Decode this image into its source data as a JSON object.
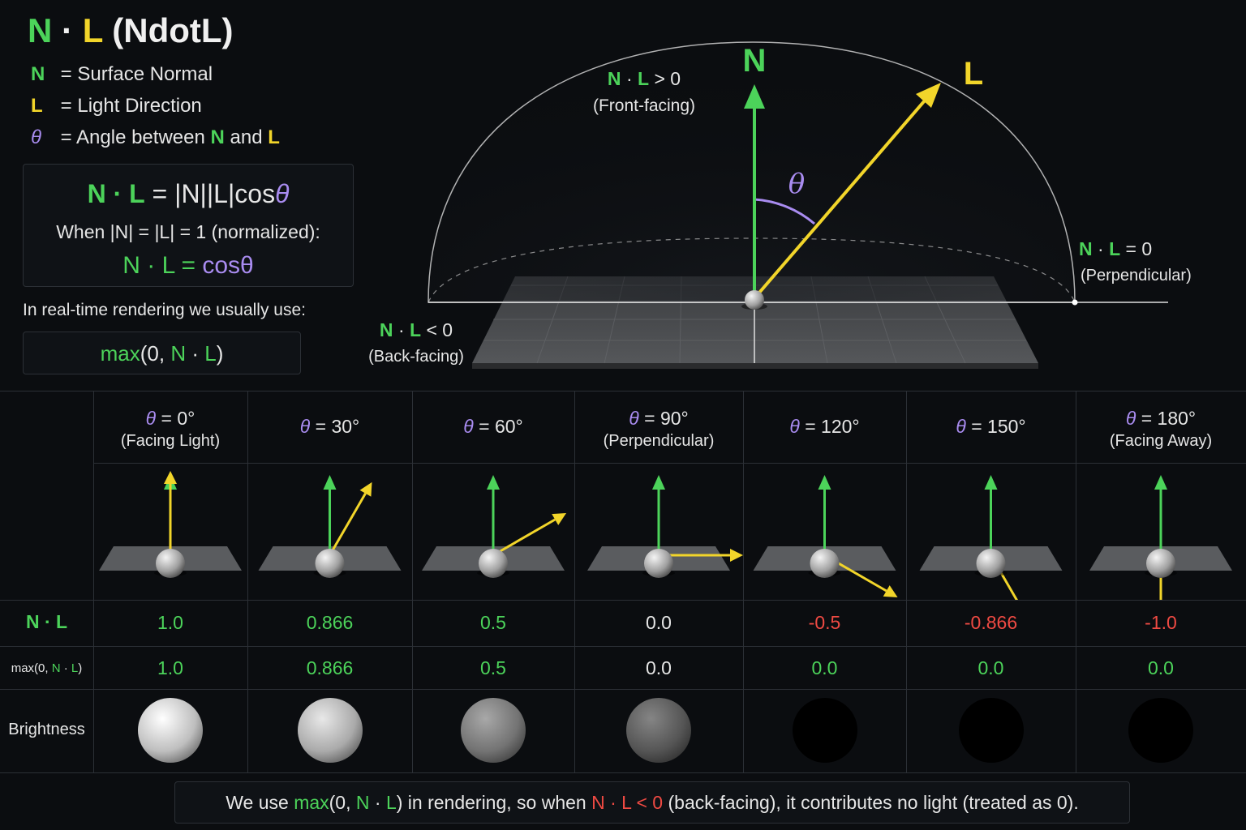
{
  "title": {
    "n": "N",
    "dot": "·",
    "l": "L",
    "rest": "(NdotL)"
  },
  "legend": [
    {
      "symbol": "N",
      "text": "= Surface Normal"
    },
    {
      "symbol": "L",
      "text": "= Light Direction"
    },
    {
      "symbol": "θ",
      "text_before": "= Angle between",
      "n": "N",
      "and": "and",
      "l": "L"
    }
  ],
  "formula": {
    "main_lhs": "N · L",
    "main_rhs": "= |N||L|cos",
    "theta": "θ",
    "when": "When |N| = |L| = 1 (normalized):",
    "cos_lhs": "N · L",
    "cos_eq": "=",
    "cos_rhs": "cosθ"
  },
  "realtime_label": "In real-time rendering we usually use:",
  "max_expr": {
    "fn": "max",
    "open": "(0,",
    "n": "N",
    "dot": "·",
    "l": "L",
    "close": ")"
  },
  "hemisphere": {
    "n_label": "N",
    "l_label": "L",
    "theta_label": "θ",
    "front": {
      "n": "N",
      "dot": "·",
      "l": "L",
      "rel": "> 0",
      "desc": "(Front-facing)"
    },
    "perp": {
      "n": "N",
      "dot": "·",
      "l": "L",
      "rel": "= 0",
      "desc": "(Perpendicular)"
    },
    "back": {
      "n": "N",
      "dot": "·",
      "l": "L",
      "rel": "< 0",
      "desc": "(Back-facing)"
    }
  },
  "table": {
    "row_labels": {
      "ndotl": "N · L",
      "max_fn": "max(0,",
      "max_n": "N",
      "max_dot": "·",
      "max_l": "L",
      "max_close": ")",
      "brightness": "Brightness"
    },
    "columns": [
      {
        "theta": "θ",
        "eq": "= 0°",
        "sub": "(Facing Light)",
        "ndotl": "1.0",
        "max": "1.0",
        "angle_deg": 0,
        "brightness": 1.0,
        "ndotl_color": "#4cd35a",
        "max_color": "#4cd35a"
      },
      {
        "theta": "θ",
        "eq": "= 30°",
        "sub": "",
        "ndotl": "0.866",
        "max": "0.866",
        "angle_deg": 30,
        "brightness": 0.866,
        "ndotl_color": "#4cd35a",
        "max_color": "#4cd35a"
      },
      {
        "theta": "θ",
        "eq": "= 60°",
        "sub": "",
        "ndotl": "0.5",
        "max": "0.5",
        "angle_deg": 60,
        "brightness": 0.5,
        "ndotl_color": "#4cd35a",
        "max_color": "#4cd35a"
      },
      {
        "theta": "θ",
        "eq": "= 90°",
        "sub": "(Perpendicular)",
        "ndotl": "0.0",
        "max": "0.0",
        "angle_deg": 90,
        "brightness": 0.3,
        "ndotl_color": "#e6e6e6",
        "max_color": "#e6e6e6"
      },
      {
        "theta": "θ",
        "eq": "= 120°",
        "sub": "",
        "ndotl": "-0.5",
        "max": "0.0",
        "angle_deg": 120,
        "brightness": 0.0,
        "ndotl_color": "#ef4a43",
        "max_color": "#4cd35a"
      },
      {
        "theta": "θ",
        "eq": "= 150°",
        "sub": "",
        "ndotl": "-0.866",
        "max": "0.0",
        "angle_deg": 150,
        "brightness": 0.0,
        "ndotl_color": "#ef4a43",
        "max_color": "#4cd35a"
      },
      {
        "theta": "θ",
        "eq": "= 180°",
        "sub": "(Facing Away)",
        "ndotl": "-1.0",
        "max": "0.0",
        "angle_deg": 180,
        "brightness": 0.0,
        "ndotl_color": "#ef4a43",
        "max_color": "#4cd35a"
      }
    ]
  },
  "footer": {
    "p1": "We use",
    "max_fn": "max",
    "p2": "(0,",
    "n": "N",
    "dot": "·",
    "l": "L",
    "p3": ") in rendering, so when",
    "neg_expr": "N · L < 0",
    "p4": "(back-facing), it contributes no light (treated as 0)."
  },
  "colors": {
    "normal": "#4cd35a",
    "light": "#f2d52a",
    "angle": "#a98cf0",
    "negative": "#ef4a43",
    "background": "#0b0d10"
  }
}
